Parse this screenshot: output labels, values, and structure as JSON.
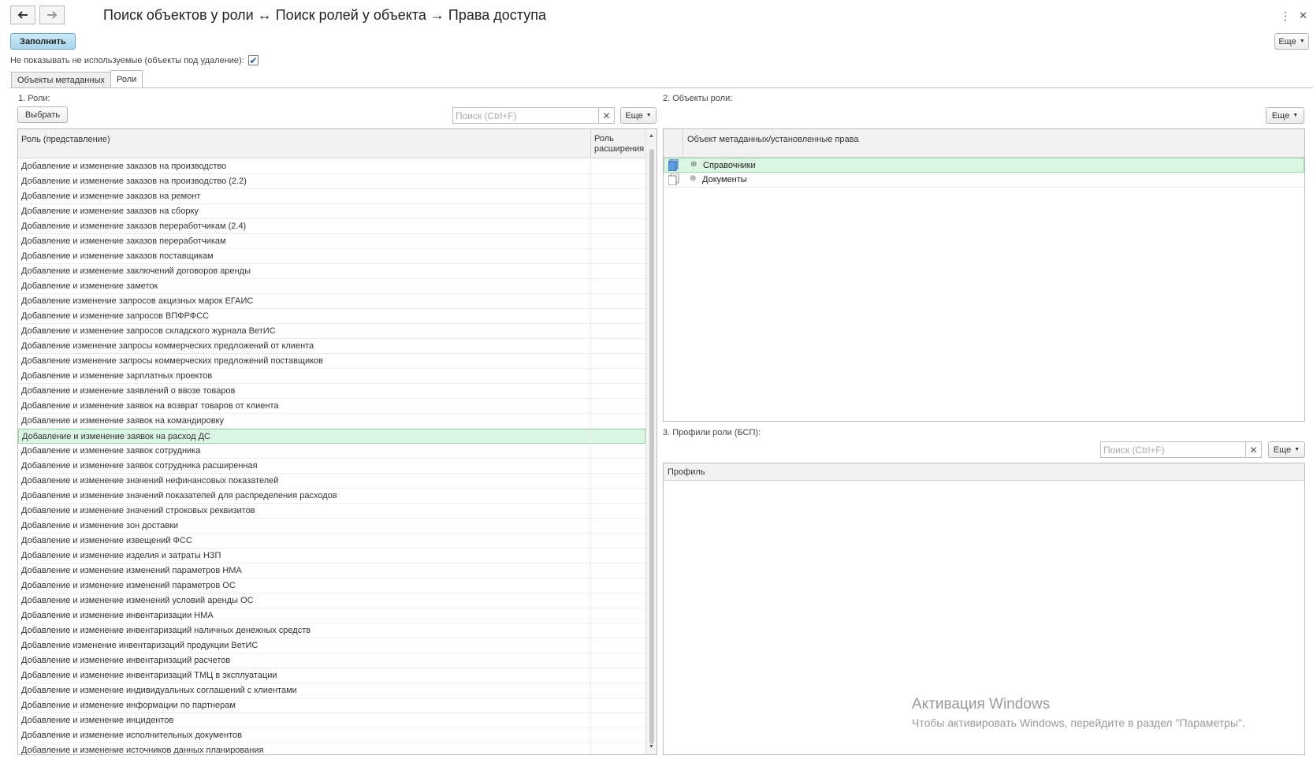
{
  "window": {
    "title": "Поиск объектов у роли ↔  Поиск ролей у объекта → Права доступа"
  },
  "toolbar": {
    "fill_label": "Заполнить",
    "more_label": "Еще"
  },
  "hide_unused": {
    "label": "Не показывать не используемые (объекты под удаление):",
    "checked": true
  },
  "tabs": [
    {
      "label": "Объекты метаданных",
      "active": false
    },
    {
      "label": "Роли",
      "active": true
    }
  ],
  "roles_panel": {
    "heading": "1. Роли:",
    "select_label": "Выбрать",
    "search_placeholder": "Поиск (Ctrl+F)",
    "more_label": "Еще",
    "col_role": "Роль (представление)",
    "col_extension": "Роль\nрасширения",
    "rows": [
      "Добавление и изменение заказов на производство",
      "Добавление и изменение заказов на производство (2.2)",
      "Добавление и изменение заказов на ремонт",
      "Добавление и изменение заказов на сборку",
      "Добавление и изменение заказов переработчикам (2.4)",
      "Добавление и изменение заказов переработчикам",
      "Добавление и изменение заказов поставщикам",
      "Добавление и изменение заключений договоров аренды",
      "Добавление и изменение заметок",
      "Добавление изменение запросов акцизных марок ЕГАИС",
      "Добавление и изменение запросов ВПФРФСС",
      "Добавление и изменение запросов складского журнала ВетИС",
      "Добавление изменение запросы коммерческих предложений от клиента",
      "Добавление изменение запросы коммерческих предложений поставщиков",
      "Добавление и изменение зарплатных проектов",
      "Добавление и изменение заявлений о ввозе товаров",
      "Добавление и изменение заявок на возврат товаров от клиента",
      "Добавление и изменение заявок на командировку",
      "Добавление и изменение заявок на расход ДС",
      "Добавление и изменение заявок сотрудника",
      "Добавление и изменение заявок сотрудника расширенная",
      "Добавление и изменение значений нефинансовых показателей",
      "Добавление и изменение значений показателей для распределения расходов",
      "Добавление и изменение значений строковых реквизитов",
      "Добавление и изменение зон доставки",
      "Добавление и изменение извещений ФСС",
      "Добавление и изменение изделия и затраты НЗП",
      "Добавление и изменение изменений параметров НМА",
      "Добавление и изменение изменений параметров ОС",
      "Добавление и изменение изменений условий аренды ОС",
      "Добавление и изменение инвентаризации НМА",
      "Добавление и изменение инвентаризаций наличных денежных средств",
      "Добавление изменение инвентаризаций продукции ВетИС",
      "Добавление и изменение инвентаризаций расчетов",
      "Добавление и изменение инвентаризаций ТМЦ в эксплуатации",
      "Добавление и изменение индивидуальных соглашений с клиентами",
      "Добавление и изменение информации по партнерам",
      "Добавление и изменение инцидентов",
      "Добавление и изменение исполнительных документов",
      "Добавление и изменение источников данных планирования"
    ],
    "selected_index": 18
  },
  "objects_panel": {
    "heading": "2. Объекты роли:",
    "more_label": "Еще",
    "col_object": "Объект метаданных/установленные права",
    "rows": [
      {
        "label": "Справочники",
        "icon": "catalogs-icon",
        "selected": true
      },
      {
        "label": "Документы",
        "icon": "documents-icon",
        "selected": false
      }
    ]
  },
  "profiles_panel": {
    "heading": "3. Профили роли (БСП):",
    "search_placeholder": "Поиск (Ctrl+F)",
    "more_label": "Еще",
    "col_profile": "Профиль"
  },
  "watermark": {
    "line1": "Активация Windows",
    "line2": "Чтобы активировать Windows, перейдите в раздел \"Параметры\"."
  }
}
